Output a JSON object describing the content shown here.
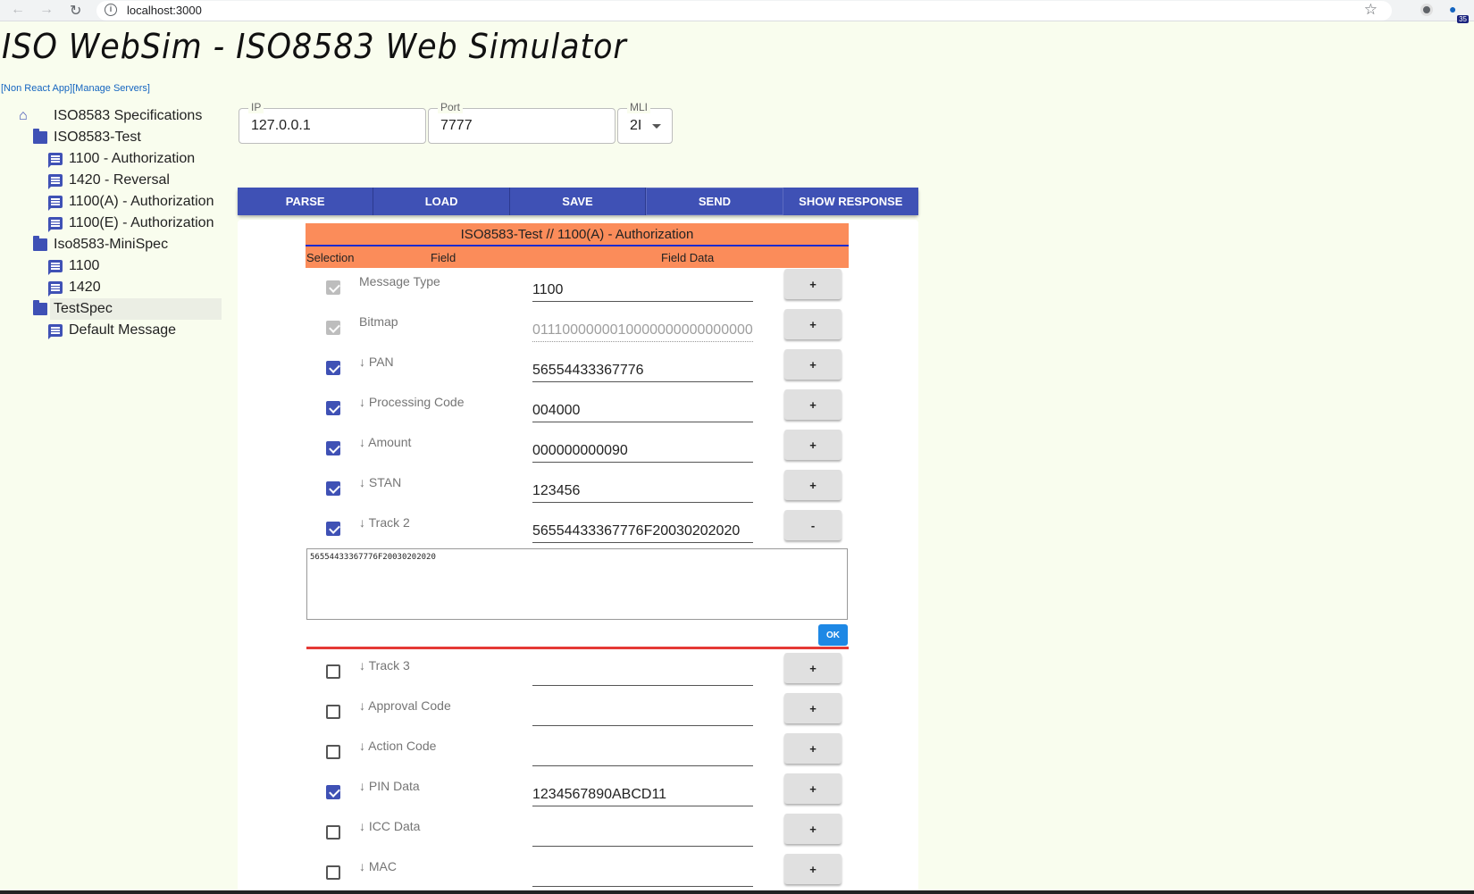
{
  "browser": {
    "url": "localhost:3000"
  },
  "app": {
    "title": "ISO WebSim - ISO8583 Web Simulator",
    "links": [
      "[Non React App]",
      "[Manage Servers]"
    ]
  },
  "tree": [
    {
      "label": "ISO8583 Specifications",
      "icon": "home-icon",
      "level": 0
    },
    {
      "label": "ISO8583-Test",
      "icon": "folder-icon",
      "level": 1
    },
    {
      "label": "1100 - Authorization",
      "icon": "message-icon",
      "level": 2
    },
    {
      "label": "1420 - Reversal",
      "icon": "message-icon",
      "level": 2
    },
    {
      "label": "1100(A) - Authorization",
      "icon": "message-icon",
      "level": 2
    },
    {
      "label": "1100(E) - Authorization",
      "icon": "message-icon",
      "level": 2
    },
    {
      "label": "Iso8583-MiniSpec",
      "icon": "folder-icon",
      "level": 1
    },
    {
      "label": "1100",
      "icon": "message-icon",
      "level": 2
    },
    {
      "label": "1420",
      "icon": "message-icon",
      "level": 2
    },
    {
      "label": "TestSpec",
      "icon": "folder-icon",
      "level": 1,
      "selected": true
    },
    {
      "label": "Default Message",
      "icon": "message-icon",
      "level": 2
    }
  ],
  "connection": {
    "ip_label": "IP",
    "ip_value": "127.0.0.1",
    "port_label": "Port",
    "port_value": "7777",
    "mli_label": "MLI",
    "mli_value": "2I"
  },
  "toolbar": [
    "PARSE",
    "LOAD",
    "SAVE",
    "SEND",
    "SHOW RESPONSE"
  ],
  "message": {
    "title": "ISO8583-Test // 1100(A) - Authorization",
    "col_selection": "Selection",
    "col_field": "Field",
    "col_data": "Field Data"
  },
  "fields": [
    {
      "name": "Message Type",
      "value": "1100",
      "checked": true,
      "disabled": true,
      "btn": "+"
    },
    {
      "name": "Bitmap",
      "value": "0111000000010000000000000000",
      "checked": true,
      "disabled": true,
      "btn": "+"
    },
    {
      "name": "↓ PAN",
      "value": "56554433367776",
      "checked": true,
      "btn": "+"
    },
    {
      "name": "↓ Processing Code",
      "value": "004000",
      "checked": true,
      "btn": "+"
    },
    {
      "name": "↓ Amount",
      "value": "000000000090",
      "checked": true,
      "btn": "+"
    },
    {
      "name": "↓ STAN",
      "value": "123456",
      "checked": true,
      "btn": "+"
    },
    {
      "name": "↓ Track 2",
      "value": "56554433367776F20030202020",
      "checked": true,
      "btn": "-"
    },
    {
      "name": "↓ Track 3",
      "value": "",
      "checked": false,
      "btn": "+"
    },
    {
      "name": "↓ Approval Code",
      "value": "",
      "checked": false,
      "btn": "+"
    },
    {
      "name": "↓ Action Code",
      "value": "",
      "checked": false,
      "btn": "+"
    },
    {
      "name": "↓ PIN Data",
      "value": "1234567890ABCD11",
      "checked": true,
      "btn": "+"
    },
    {
      "name": "↓ ICC Data",
      "value": "",
      "checked": false,
      "btn": "+"
    },
    {
      "name": "↓ MAC",
      "value": "",
      "checked": false,
      "btn": "+"
    }
  ],
  "editor": {
    "value": "56554433367776F20030202020",
    "ok_label": "OK"
  },
  "colors": {
    "primary": "#3f51b5",
    "header": "#fb8c5a",
    "background": "#f9fdee"
  }
}
